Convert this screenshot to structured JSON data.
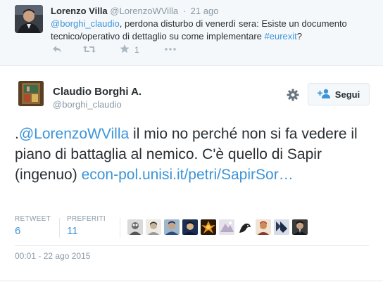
{
  "reply": {
    "name": "Lorenzo Villa",
    "handle": "@LorenzoWVilla",
    "time": "21 ago",
    "mention": "@borghi_claudio",
    "text_body": ", perdona disturbo di venerdì sera: Esiste un documento tecnico/operativo di dettaglio su come implementare ",
    "hashtag": "#eurexit",
    "text_end": "?",
    "favorite_count": "1",
    "icons": [
      "reply-icon",
      "retweet-icon",
      "favorite-icon",
      "more-icon"
    ]
  },
  "tweet": {
    "name": "Claudio Borghi A.",
    "handle": "@borghi_claudio",
    "follow_label": "Segui",
    "text_prefix": ".",
    "mention": "@LorenzoWVilla",
    "text_body": " il mio no perché non si fa vedere il piano di battaglia al nemico. C'è quello di Sapir (ingenuo) ",
    "link": "econ-pol.unisi.it/petri/SapirSor…",
    "retweet_label": "RETWEET",
    "retweet_count": "6",
    "favorites_label": "PREFERITI",
    "favorites_count": "11",
    "timestamp": "00:01 - 22 ago 2015"
  },
  "colors": {
    "link": "#3b94d9",
    "muted": "#8899a6",
    "text": "#292f33",
    "reply_bg": "#f5f8fa"
  }
}
